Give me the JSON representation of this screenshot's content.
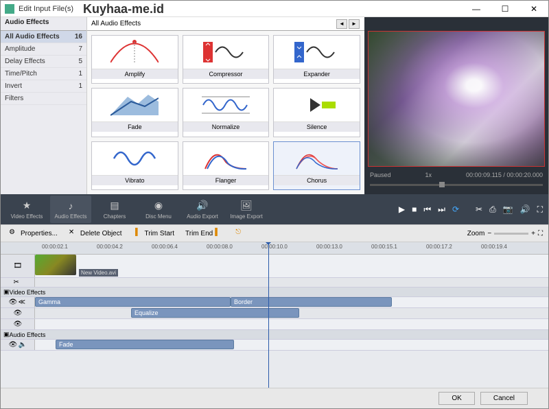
{
  "window": {
    "title": "Edit Input File(s)"
  },
  "watermark": "Kuyhaa-me.id",
  "sidebar": {
    "tab_active": "Audio Effects",
    "categories": [
      {
        "label": "All Audio Effects",
        "count": "16",
        "active": true
      },
      {
        "label": "Amplitude",
        "count": "7"
      },
      {
        "label": "Delay Effects",
        "count": "5"
      },
      {
        "label": "Time/Pitch",
        "count": "1"
      },
      {
        "label": "Invert",
        "count": "1"
      },
      {
        "label": "Filters",
        "count": ""
      }
    ]
  },
  "center": {
    "tab": "All Audio Effects",
    "effects": [
      {
        "label": "Amplify"
      },
      {
        "label": "Compressor"
      },
      {
        "label": "Expander"
      },
      {
        "label": "Fade"
      },
      {
        "label": "Normalize"
      },
      {
        "label": "Silence"
      },
      {
        "label": "Vibrato"
      },
      {
        "label": "Flanger"
      },
      {
        "label": "Chorus",
        "selected": true
      }
    ]
  },
  "preview": {
    "status": "Paused",
    "speed": "1x",
    "time": "00:00:09.115 / 00:00:20.000"
  },
  "ribbon": {
    "items": [
      {
        "label": "Video Effects",
        "icon": "★"
      },
      {
        "label": "Audio Effects",
        "icon": "♪",
        "active": true
      },
      {
        "label": "Chapters",
        "icon": "▤"
      },
      {
        "label": "Disc Menu",
        "icon": "◉"
      },
      {
        "label": "Audio Export",
        "icon": "🔊"
      },
      {
        "label": "Image Export",
        "icon": "🖼"
      }
    ]
  },
  "toolbar2": {
    "properties": "Properties...",
    "delete": "Delete Object",
    "trim_start": "Trim Start",
    "trim_end": "Trim End",
    "zoom": "Zoom"
  },
  "timeline": {
    "marks": [
      "00:00:02.1",
      "00:00:04.2",
      "00:00:06.4",
      "00:00:08.0",
      "00:00:10.0",
      "00:00:13.0",
      "00:00:15.1",
      "00:00:17.2",
      "00:00:19.4"
    ],
    "video_clip_label": "New Video.avi",
    "sections": {
      "video_effects": "Video Effects",
      "audio_effects": "Audio Effects"
    },
    "clips": {
      "gamma": "Gamma",
      "border": "Border",
      "equalize": "Equalize",
      "fade": "Fade"
    }
  },
  "footer": {
    "ok": "OK",
    "cancel": "Cancel"
  }
}
